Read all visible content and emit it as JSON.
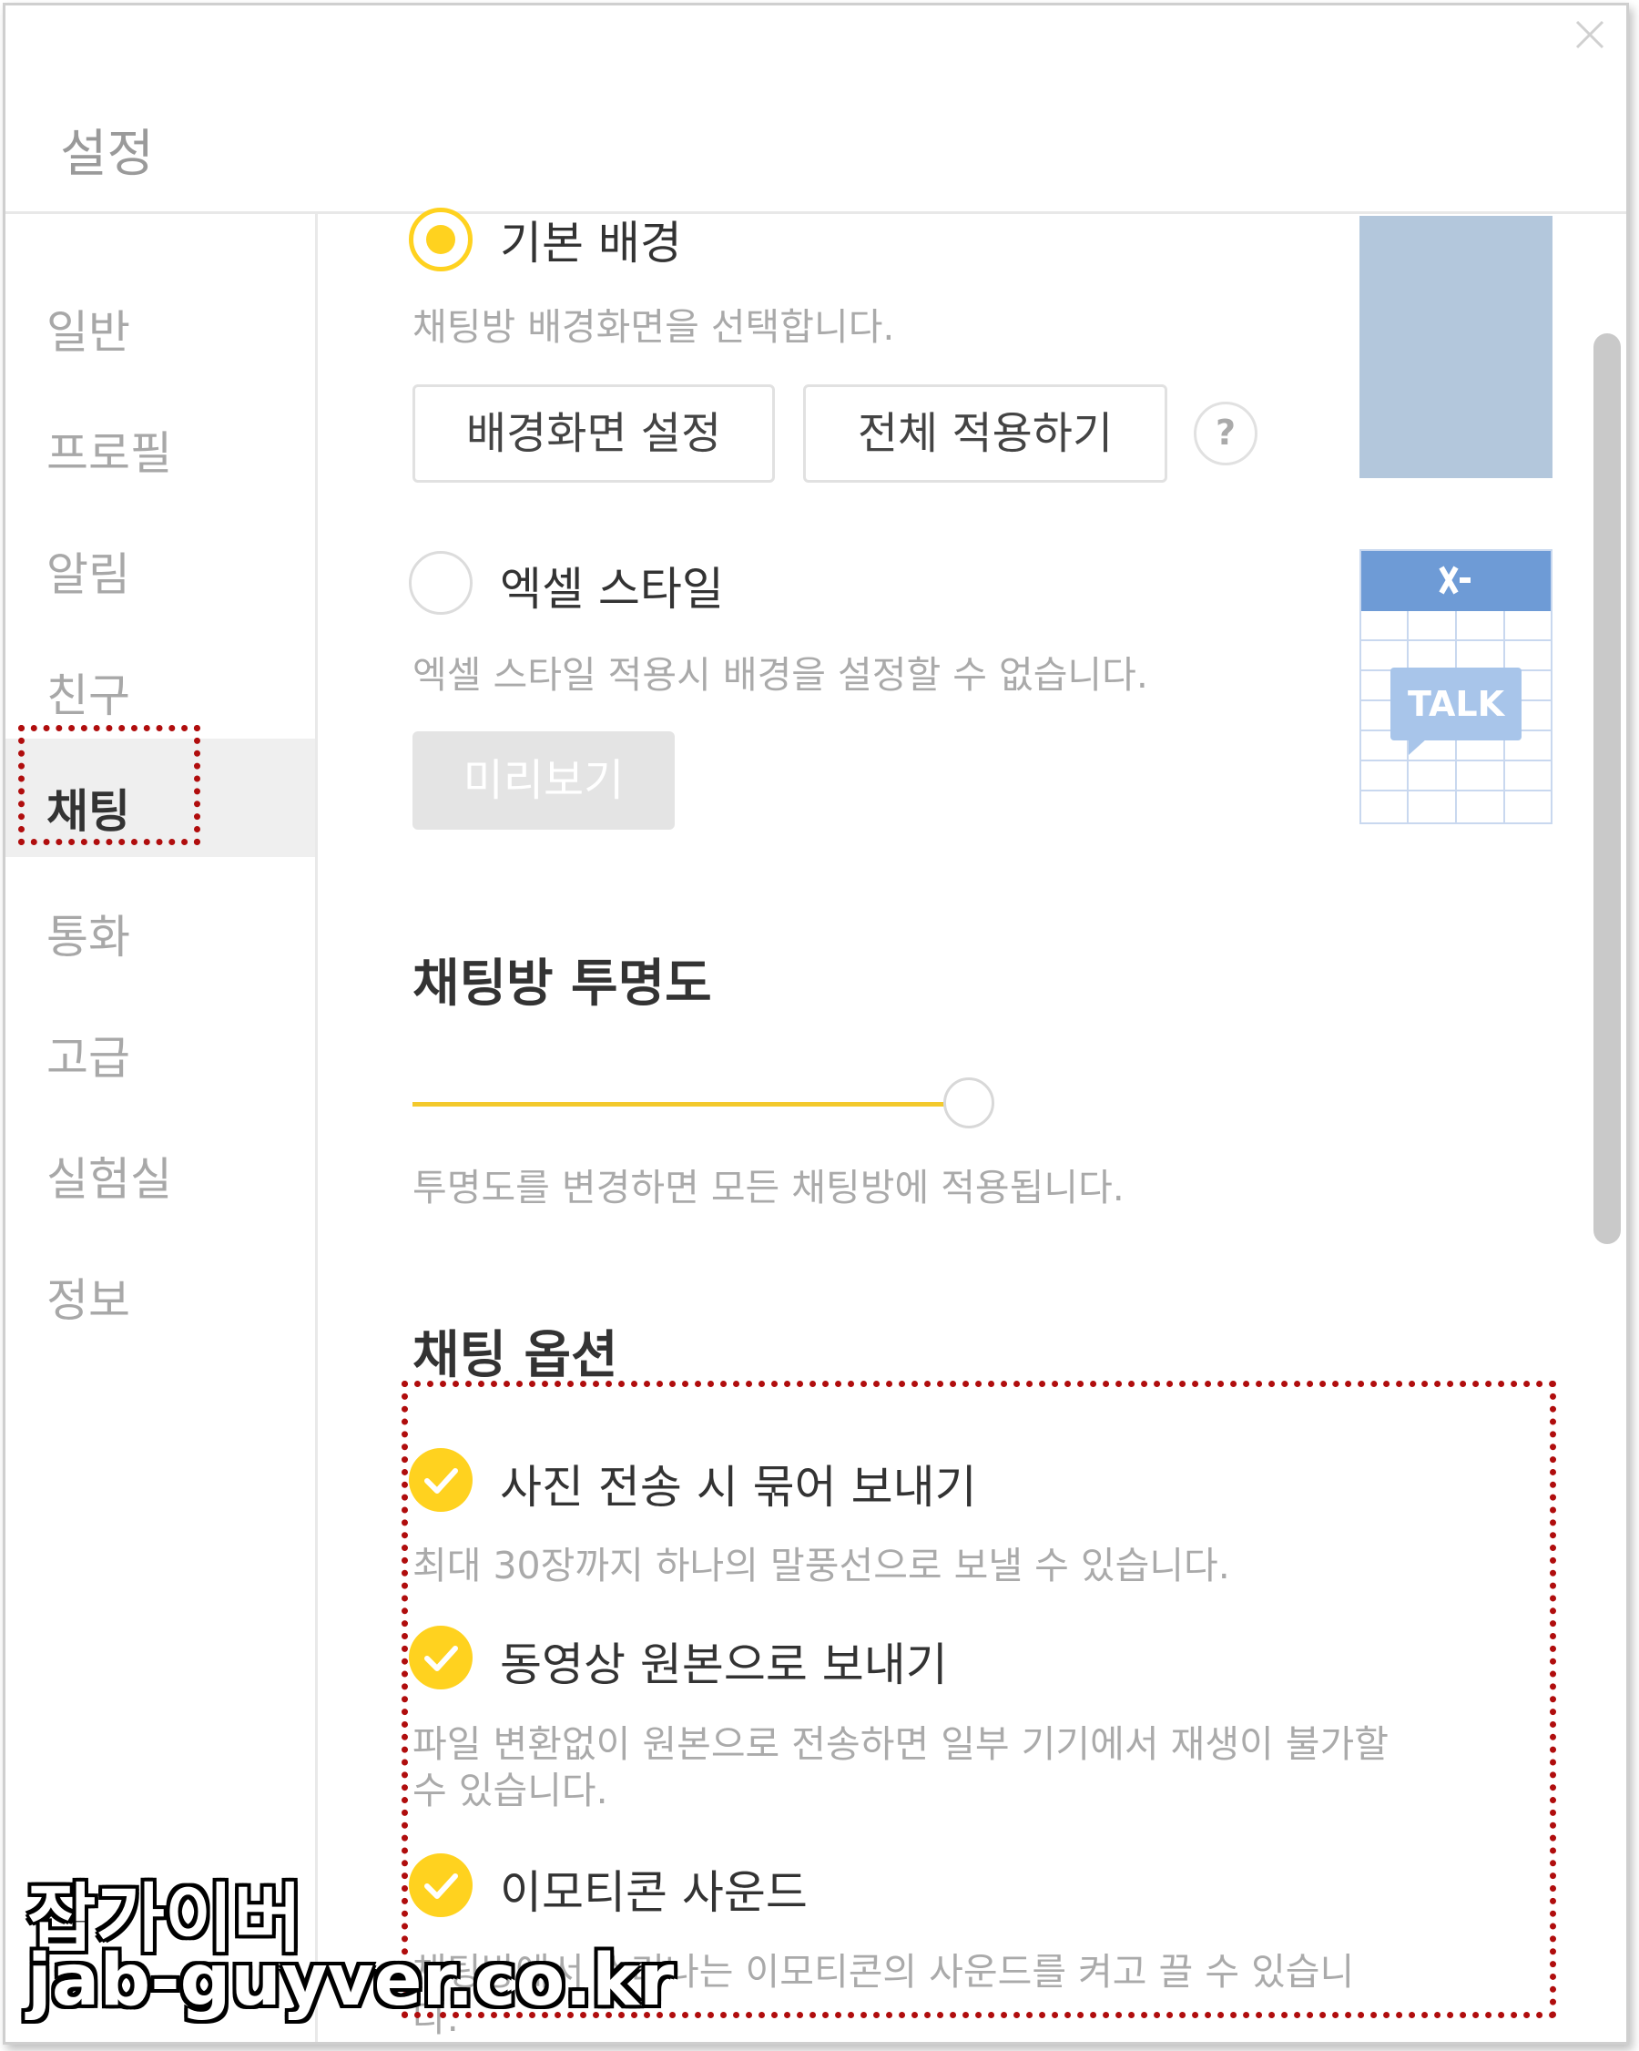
{
  "window": {
    "title": "설정",
    "close_icon": "close-icon"
  },
  "sidebar": {
    "items": [
      {
        "label": "일반"
      },
      {
        "label": "프로필"
      },
      {
        "label": "알림"
      },
      {
        "label": "친구"
      },
      {
        "label": "채팅",
        "active": true
      },
      {
        "label": "통화"
      },
      {
        "label": "고급"
      },
      {
        "label": "실험실"
      },
      {
        "label": "정보"
      }
    ]
  },
  "background": {
    "basic_label": "기본 배경",
    "basic_selected": true,
    "basic_desc": "채팅방 배경화면을 선택합니다.",
    "set_button": "배경화면 설정",
    "apply_all_button": "전체 적용하기",
    "help_glyph": "?",
    "excel_label": "엑셀 스타일",
    "excel_selected": false,
    "excel_desc": "엑셀 스타일 적용시 배경을 설정할 수 없습니다.",
    "preview_button": "미리보기",
    "excel_thumb_text": "TALK",
    "thumb_basic_color": "#b3c7dc",
    "thumb_excel_header_color": "#6e9bd6"
  },
  "transparency": {
    "heading": "채팅방 투명도",
    "value_percent": 100,
    "desc": "투명도를 변경하면 모든 채팅방에 적용됩니다."
  },
  "chat_options": {
    "heading": "채팅 옵션",
    "items": [
      {
        "label": "사진 전송 시 묶어 보내기",
        "checked": true,
        "desc": [
          "최대 30장까지 하나의 말풍선으로 보낼 수 있습니다."
        ]
      },
      {
        "label": "동영상 원본으로 보내기",
        "checked": true,
        "desc": [
          "파일 변환없이 원본으로 전송하면 일부 기기에서 재생이 불가할",
          "수 있습니다."
        ]
      },
      {
        "label": "이모티콘 사운드",
        "checked": true,
        "desc": [
          "채팅방에서 소리나는 이모티콘의 사운드를 켜고 끌 수 있습니",
          "다."
        ]
      }
    ]
  },
  "colors": {
    "accent": "#ffd21f",
    "highlight_border": "#b00d0d"
  },
  "watermark": {
    "line1": "잡가이버",
    "line2": "jab-guyver.co.kr"
  }
}
